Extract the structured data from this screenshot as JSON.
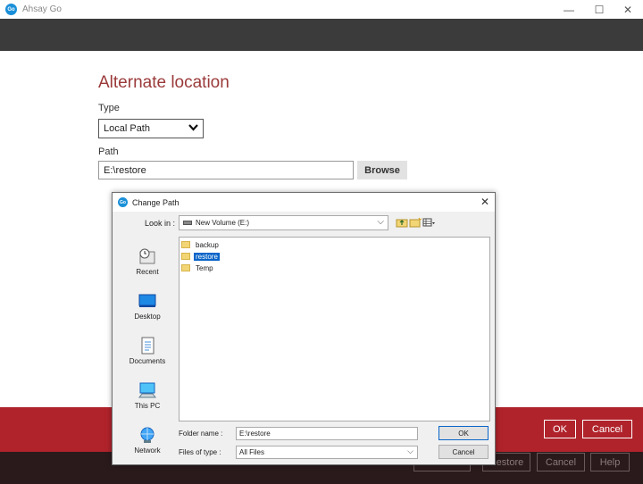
{
  "window": {
    "title": "Ahsay Go",
    "logo_text": "Go",
    "controls": {
      "minimize": "—",
      "maximize": "☐",
      "close": "✕"
    }
  },
  "main": {
    "page_title": "Alternate location",
    "type_label": "Type",
    "type_value": "Local Path",
    "path_label": "Path",
    "path_value": "E:\\restore",
    "browse_label": "Browse",
    "ok_label": "OK",
    "cancel_label": "Cancel"
  },
  "bottom_bar": {
    "buttons": [
      "",
      "Restore",
      "Cancel",
      "Help"
    ]
  },
  "dialog": {
    "title": "Change Path",
    "close": "✕",
    "look_in_label": "Look in :",
    "look_in_value": "New Volume (E:)",
    "places": [
      "Recent",
      "Desktop",
      "Documents",
      "This PC",
      "Network"
    ],
    "files": [
      {
        "name": "backup",
        "selected": false
      },
      {
        "name": "restore",
        "selected": true
      },
      {
        "name": "Temp",
        "selected": false
      }
    ],
    "folder_name_label": "Folder name :",
    "folder_name_value": "E:\\restore",
    "files_of_type_label": "Files of type :",
    "files_of_type_value": "All Files",
    "ok_label": "OK",
    "cancel_label": "Cancel"
  },
  "colors": {
    "accent_red": "#b0232b",
    "title_red": "#9b3a3a",
    "dark_band": "#3b3b3b",
    "selection_blue": "#0a64c8"
  }
}
